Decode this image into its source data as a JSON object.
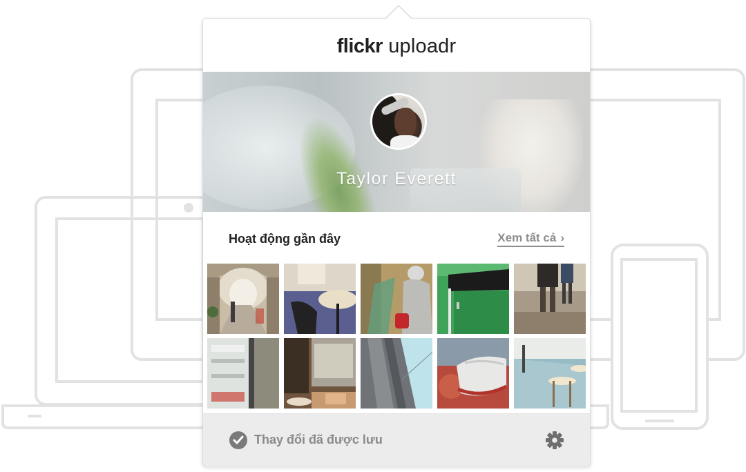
{
  "header": {
    "brand": "flickr",
    "app": "uploadr"
  },
  "profile": {
    "name": "Taylor Everett"
  },
  "activity": {
    "title": "Hoạt động gần đây",
    "see_all": "Xem tất cả",
    "see_all_chevron": "›",
    "photos": [
      {
        "icon": "arcade-corridor-photo"
      },
      {
        "icon": "cafe-chair-photo"
      },
      {
        "icon": "hooded-person-photo"
      },
      {
        "icon": "green-door-photo"
      },
      {
        "icon": "legs-walking-photo"
      },
      {
        "icon": "shop-window-photo"
      },
      {
        "icon": "cafe-terrace-photo"
      },
      {
        "icon": "building-sky-photo"
      },
      {
        "icon": "sneaker-photo"
      },
      {
        "icon": "stools-photo"
      }
    ]
  },
  "footer": {
    "status": "Thay đổi đã được lưu"
  },
  "colors": {
    "accent_gray": "#7a7a7a",
    "footer_bg": "#ececec"
  }
}
